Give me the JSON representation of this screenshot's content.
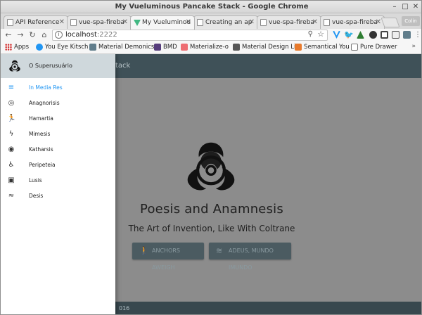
{
  "window": {
    "title": "My Vueluminous Pancake Stack - Google Chrome"
  },
  "tabs": [
    {
      "label": "API Reference",
      "active": false,
      "icon": "page-icon"
    },
    {
      "label": "vue-spa-fireba",
      "active": false,
      "icon": "page-icon"
    },
    {
      "label": "My Vueluminou",
      "active": true,
      "icon": "vue-icon"
    },
    {
      "label": "Creating an ap",
      "active": false,
      "icon": "page-icon"
    },
    {
      "label": "vue-spa-fireba",
      "active": false,
      "icon": "page-icon"
    },
    {
      "label": "vue-spa-fireba",
      "active": false,
      "icon": "page-icon"
    }
  ],
  "profile": {
    "label": "Colin"
  },
  "address": {
    "host": "localhost",
    "port": ":2222"
  },
  "bookmarks": [
    {
      "label": "Apps",
      "color": "#e0a030"
    },
    {
      "label": "You Eye Kitsch",
      "color": "#2196f3"
    },
    {
      "label": "Material Demonics",
      "color": "#607d8b"
    },
    {
      "label": "BMD",
      "color": "#563d7c"
    },
    {
      "label": "Materialize-o",
      "color": "#ee6e73"
    },
    {
      "label": "Material Design Li",
      "color": "#555555"
    },
    {
      "label": "Semantical You",
      "color": "#e87a2c"
    },
    {
      "label": "Pure Drawer",
      "color": "#777777"
    }
  ],
  "app": {
    "title_partial": "tack",
    "footer_partial": "016",
    "hero": {
      "title": "Poesis and Anamnesis",
      "subtitle": "The Art of Invention, Like With Coltrane",
      "buttons": [
        {
          "label": "ANCHORS AWEIGH",
          "icon": "walk-icon"
        },
        {
          "label": "ADEUS, MUNDO IMUNDO",
          "icon": "swim-icon"
        }
      ]
    }
  },
  "drawer": {
    "user": "O Superusuário",
    "items": [
      {
        "label": "In Media Res",
        "icon": "menu-icon",
        "active": true
      },
      {
        "label": "Anagnorisis",
        "icon": "target-icon",
        "active": false
      },
      {
        "label": "Hamartia",
        "icon": "run-icon",
        "active": false
      },
      {
        "label": "Mimesis",
        "icon": "flash-icon",
        "active": false
      },
      {
        "label": "Katharsis",
        "icon": "eye-icon",
        "active": false
      },
      {
        "label": "Peripeteia",
        "icon": "accessible-icon",
        "active": false
      },
      {
        "label": "Lusis",
        "icon": "luggage-icon",
        "active": false
      },
      {
        "label": "Desis",
        "icon": "pool-icon",
        "active": false
      }
    ]
  },
  "colors": {
    "appbar": "#3f5158",
    "accent": "#2196f3",
    "footer": "#38484e"
  }
}
